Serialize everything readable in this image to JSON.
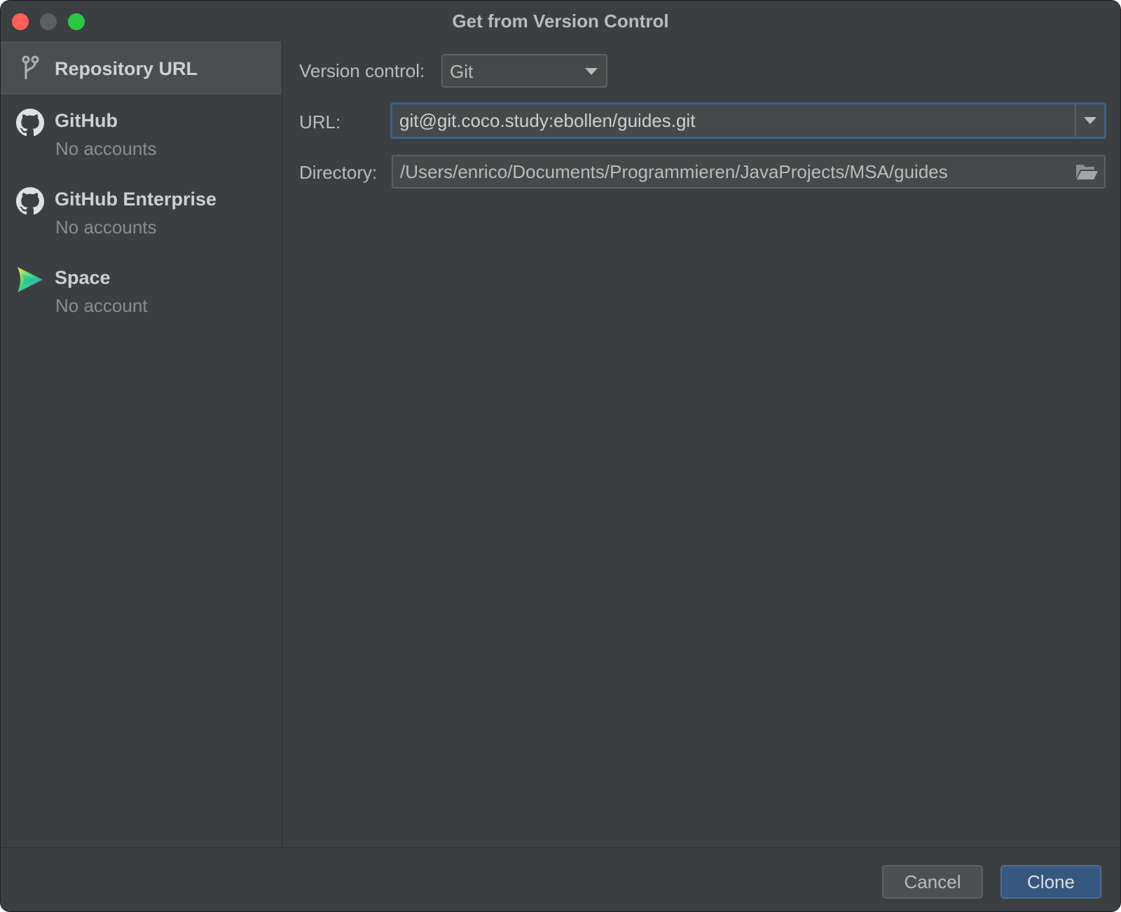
{
  "window": {
    "title": "Get from Version Control"
  },
  "sidebar": {
    "items": [
      {
        "label": "Repository URL",
        "sub": "",
        "icon": "vcs-branch-icon",
        "selected": true
      },
      {
        "label": "GitHub",
        "sub": "No accounts",
        "icon": "github-icon"
      },
      {
        "label": "GitHub Enterprise",
        "sub": "No accounts",
        "icon": "github-icon"
      },
      {
        "label": "Space",
        "sub": "No account",
        "icon": "space-icon"
      }
    ]
  },
  "form": {
    "version_control_label": "Version control:",
    "version_control_value": "Git",
    "url_label": "URL:",
    "url_value": "git@git.coco.study:ebollen/guides.git",
    "directory_label": "Directory:",
    "directory_value": "/Users/enrico/Documents/Programmieren/JavaProjects/MSA/guides"
  },
  "buttons": {
    "cancel": "Cancel",
    "clone": "Clone"
  },
  "colors": {
    "background": "#3c3f41",
    "selected": "#4b4e51",
    "focus_border": "#3d6185",
    "primary_button": "#365880"
  }
}
